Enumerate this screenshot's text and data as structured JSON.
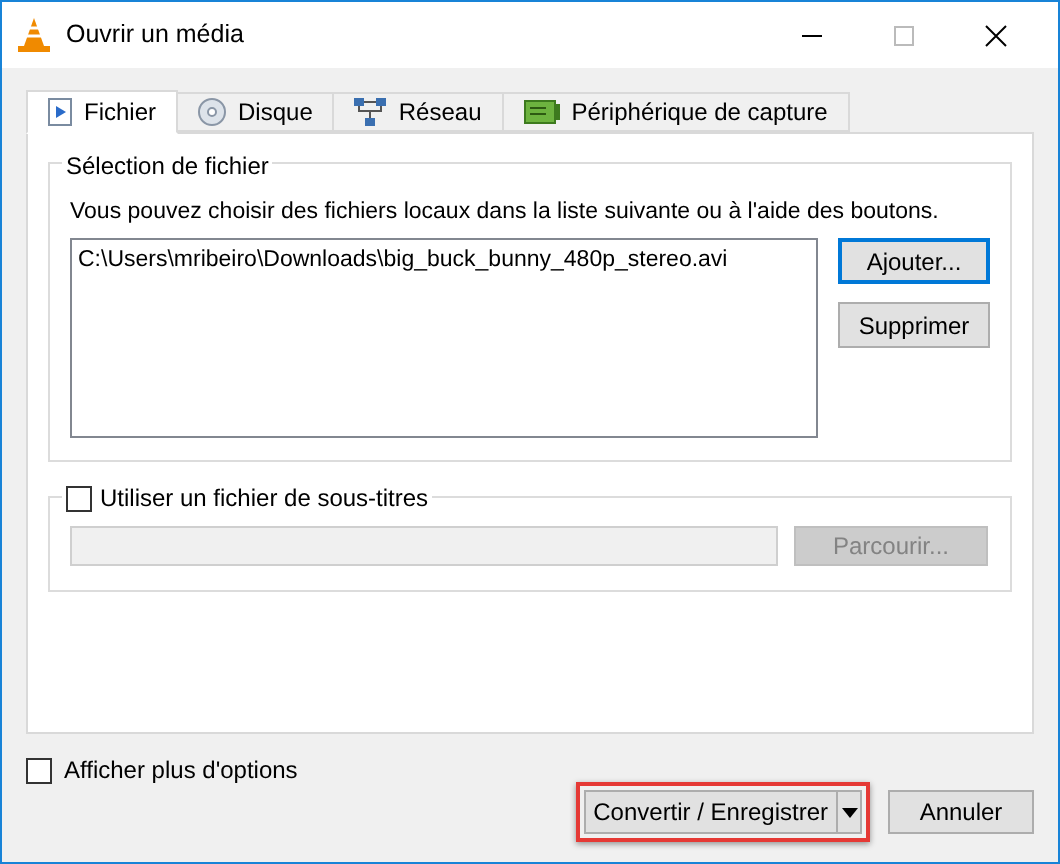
{
  "window": {
    "title": "Ouvrir un média"
  },
  "tabs": [
    {
      "label": "Fichier",
      "selected": true
    },
    {
      "label": "Disque",
      "selected": false
    },
    {
      "label": "Réseau",
      "selected": false
    },
    {
      "label": "Périphérique de capture",
      "selected": false
    }
  ],
  "file_selection": {
    "title": "Sélection de fichier",
    "description": "Vous pouvez choisir des fichiers locaux dans la liste suivante ou à l'aide des boutons.",
    "files": [
      "C:\\Users\\mribeiro\\Downloads\\big_buck_bunny_480p_stereo.avi"
    ],
    "buttons": [
      {
        "label": "Ajouter...",
        "focused": true
      },
      {
        "label": "Supprimer",
        "focused": false
      }
    ]
  },
  "subtitles": {
    "label": "Utiliser un fichier de sous-titres",
    "checked": false,
    "browse_button": {
      "label": "Parcourir...",
      "disabled": true
    }
  },
  "more_options": {
    "label": "Afficher plus d'options",
    "checked": false
  },
  "buttons": [
    {
      "label": "Convertir / Enregistrer",
      "kind": "split",
      "highlighted": true
    },
    {
      "label": "Annuler",
      "kind": "plain",
      "highlighted": false
    }
  ]
}
